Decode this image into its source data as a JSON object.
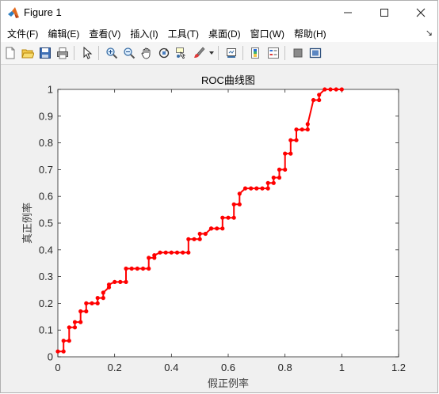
{
  "window": {
    "title": "Figure 1",
    "controls": {
      "minimize": "—",
      "maximize": "☐",
      "close": "✕"
    }
  },
  "menubar": {
    "items": [
      "文件(F)",
      "编辑(E)",
      "查看(V)",
      "插入(I)",
      "工具(T)",
      "桌面(D)",
      "窗口(W)",
      "帮助(H)"
    ],
    "pin": "↘"
  },
  "toolbar": {
    "icons": [
      "new-figure-icon",
      "open-file-icon",
      "save-icon",
      "print-icon",
      "pointer-icon",
      "zoom-in-icon",
      "zoom-out-icon",
      "pan-icon",
      "rotate-3d-icon",
      "data-cursor-icon",
      "brush-icon",
      "link-plot-icon",
      "colorbar-icon",
      "legend-icon",
      "hide-plot-tools-icon",
      "show-plot-tools-icon"
    ]
  },
  "chart_data": {
    "type": "line",
    "title": "ROC曲线图",
    "xlabel": "假正例率",
    "ylabel": "真正例率",
    "xlim": [
      0,
      1.2
    ],
    "ylim": [
      0,
      1
    ],
    "xticks": [
      "0",
      "0.2",
      "0.4",
      "0.6",
      "0.8",
      "1",
      "1.2"
    ],
    "yticks": [
      "0",
      "0.1",
      "0.2",
      "0.3",
      "0.4",
      "0.5",
      "0.6",
      "0.7",
      "0.8",
      "0.9",
      "1"
    ],
    "grid": false,
    "series": [
      {
        "color": "#ff0000",
        "marker": "circle",
        "x": [
          0,
          0.02,
          0.02,
          0.04,
          0.04,
          0.06,
          0.06,
          0.08,
          0.08,
          0.1,
          0.1,
          0.12,
          0.14,
          0.14,
          0.16,
          0.16,
          0.18,
          0.18,
          0.2,
          0.22,
          0.24,
          0.24,
          0.26,
          0.28,
          0.3,
          0.32,
          0.32,
          0.34,
          0.34,
          0.36,
          0.38,
          0.4,
          0.42,
          0.44,
          0.46,
          0.46,
          0.48,
          0.5,
          0.5,
          0.52,
          0.54,
          0.54,
          0.56,
          0.58,
          0.58,
          0.6,
          0.62,
          0.62,
          0.64,
          0.64,
          0.66,
          0.68,
          0.7,
          0.72,
          0.74,
          0.74,
          0.76,
          0.76,
          0.78,
          0.78,
          0.8,
          0.8,
          0.82,
          0.82,
          0.84,
          0.84,
          0.86,
          0.88,
          0.88,
          0.9,
          0.92,
          0.92,
          0.94,
          0.96,
          0.98,
          1.0
        ],
        "y": [
          0.02,
          0.02,
          0.06,
          0.06,
          0.11,
          0.11,
          0.13,
          0.13,
          0.17,
          0.17,
          0.2,
          0.2,
          0.2,
          0.22,
          0.22,
          0.24,
          0.26,
          0.27,
          0.28,
          0.28,
          0.28,
          0.33,
          0.33,
          0.33,
          0.33,
          0.33,
          0.37,
          0.37,
          0.38,
          0.39,
          0.39,
          0.39,
          0.39,
          0.39,
          0.39,
          0.44,
          0.44,
          0.44,
          0.46,
          0.46,
          0.48,
          0.48,
          0.48,
          0.48,
          0.52,
          0.52,
          0.52,
          0.57,
          0.57,
          0.61,
          0.63,
          0.63,
          0.63,
          0.63,
          0.63,
          0.65,
          0.65,
          0.67,
          0.67,
          0.7,
          0.7,
          0.76,
          0.76,
          0.81,
          0.81,
          0.85,
          0.85,
          0.85,
          0.87,
          0.96,
          0.96,
          0.98,
          1.0,
          1.0,
          1.0,
          1.0
        ]
      }
    ]
  }
}
